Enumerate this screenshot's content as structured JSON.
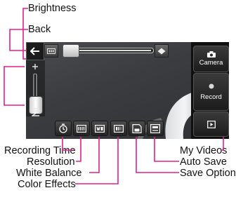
{
  "callouts": {
    "brightness": "Brightness",
    "back": "Back",
    "recording_time": "Recording Time",
    "resolution": "Resolution",
    "white_balance": "White Balance",
    "color_effects": "Color Effects",
    "my_videos": "My Videos",
    "auto_save": "Auto Save",
    "save_option": "Save Option"
  },
  "side_panel": {
    "camera_label": "Camera",
    "record_label": "Record"
  },
  "colors": {
    "callout_line": "#e0218a",
    "screen_bg": "#3b3d40",
    "panel_bg": "#101010",
    "label_text": "#111111"
  },
  "icons": {
    "back": "arrow-left-icon",
    "brightness_minus": "brightness-low-icon",
    "brightness_plus": "brightness-high-icon",
    "zoom_in": "zoom-in-icon",
    "zoom_out": "zoom-out-icon",
    "camera": "camera-icon",
    "record": "record-dot-icon",
    "my_videos": "video-gallery-icon",
    "recording_time": "timer-icon",
    "resolution": "resolution-icon",
    "white_balance": "white-balance-icon",
    "color_effects": "color-effects-icon",
    "save_option": "memory-card-icon",
    "auto_save": "auto-save-icon"
  }
}
